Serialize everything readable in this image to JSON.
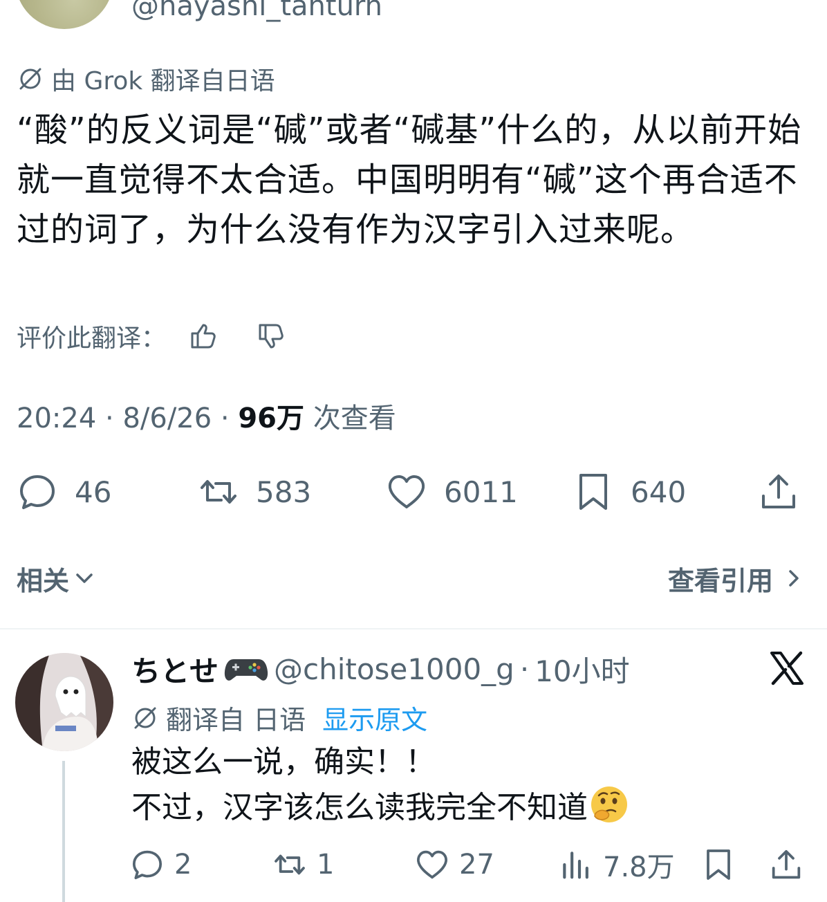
{
  "tweet": {
    "handle": "@hayashi_tanturn",
    "translation_note": "由 Grok 翻译自日语",
    "body": "“酸”的反义词是“碱”或者“碱基”什么的，从以前开始就一直觉得不太合适。中国明明有“碱”这个再合适不过的词了，为什么没有作为汉字引入过来呢。",
    "rate_label": "评价此翻译：",
    "time": "20:24",
    "date": "8/6/26",
    "views_count": "96万",
    "views_label": "次查看",
    "stats": {
      "replies": "46",
      "retweets": "583",
      "likes": "6011",
      "bookmarks": "640"
    },
    "icons": [
      "translate-icon",
      "thumbs-up-icon",
      "thumbs-down-icon",
      "reply-icon",
      "retweet-icon",
      "like-icon",
      "bookmark-icon",
      "share-icon"
    ]
  },
  "related": {
    "label": "相关",
    "quotes_link": "查看引用"
  },
  "reply": {
    "name": "ちとせ",
    "name_emoji": "gamepad-icon",
    "handle": "@chitose1000_g",
    "separator": "·",
    "time": "10小时",
    "translation_note": "翻译自 日语",
    "show_original": "显示原文",
    "line1": "被这么一说，确实！！",
    "line2": "不过，汉字该怎么读我完全不知道",
    "line2_emoji": "thinking-face-emoji",
    "stats": {
      "replies": "2",
      "retweets": "1",
      "likes": "27",
      "views": "7.8万"
    }
  },
  "colors": {
    "text_primary": "#0f1419",
    "text_secondary": "#536471",
    "link_blue": "#1d9bf0",
    "divider": "#eff3f4"
  }
}
